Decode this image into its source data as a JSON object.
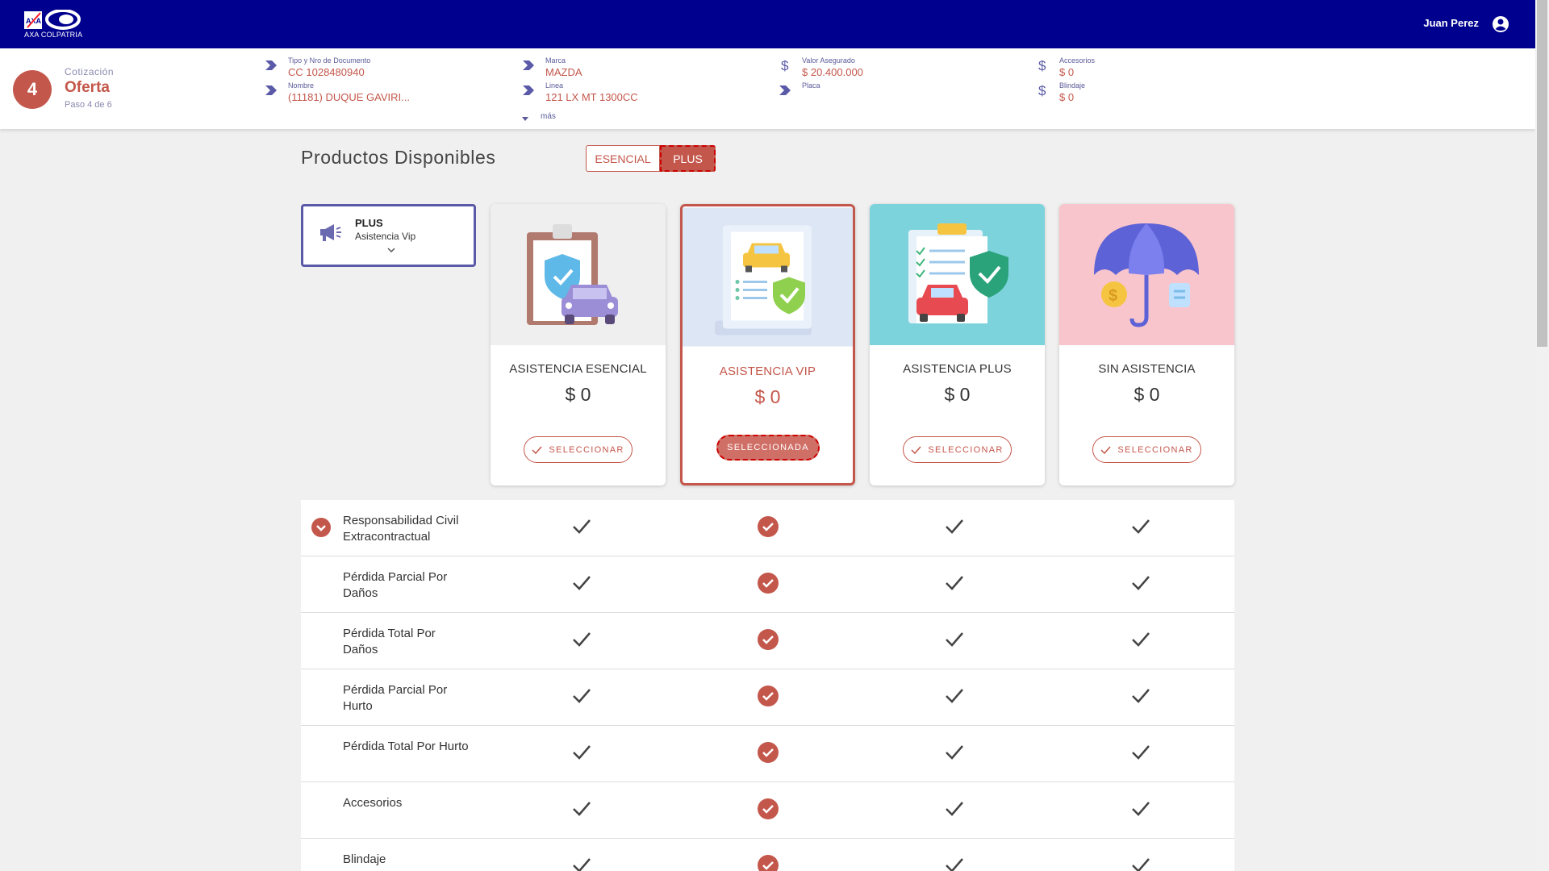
{
  "header": {
    "brand": "AXA COLPATRIA",
    "user_name": "Juan Perez"
  },
  "step": {
    "number": "4",
    "kicker": "Cotización",
    "title": "Oferta",
    "subtitle": "Paso 4 de 6"
  },
  "summary": {
    "doc_label": "Tipo y Nro de Documento",
    "doc_value": "CC 1028480940",
    "name_label": "Nombre",
    "name_value": "(11181) DUQUE GAVIRI...",
    "marca_label": "Marca",
    "marca_value": "MAZDA",
    "linea_label": "Linea",
    "linea_value": "121 LX MT 1300CC",
    "mas": "más",
    "valor_label": "Valor Asegurado",
    "valor_value": "$ 20.400.000",
    "placa_label": "Placa",
    "placa_value": "",
    "accesorios_label": "Accesorios",
    "accesorios_value": "$ 0",
    "blindaje_label": "Blindaje",
    "blindaje_value": "$ 0"
  },
  "main": {
    "title": "Productos Disponibles",
    "toggle": [
      "ESENCIAL",
      "PLUS"
    ],
    "toggle_selected": "PLUS",
    "plan_select": {
      "title": "PLUS",
      "subtitle": "Asistencia Vip"
    }
  },
  "cards": [
    {
      "name": "ASISTENCIA ESENCIAL",
      "price": "$ 0",
      "button": "SELECCIONAR",
      "selected": false,
      "bg": "#efefef"
    },
    {
      "name": "ASISTENCIA VIP",
      "price": "$ 0",
      "button": "SELECCIONADA",
      "selected": true,
      "bg": "#dce6f4"
    },
    {
      "name": "ASISTENCIA PLUS",
      "price": "$ 0",
      "button": "SELECCIONAR",
      "selected": false,
      "bg": "#7dd3dc"
    },
    {
      "name": "SIN ASISTENCIA",
      "price": "$ 0",
      "button": "SELECCIONAR",
      "selected": false,
      "bg": "#f8c5cc"
    }
  ],
  "coverages": [
    {
      "label": "Responsabilidad Civil Extracontractual",
      "expandable": true
    },
    {
      "label": "Pérdida Parcial Por Daños",
      "expandable": false
    },
    {
      "label": "Pérdida Total Por Daños",
      "expandable": false
    },
    {
      "label": "Pérdida Parcial Por Hurto",
      "expandable": false
    },
    {
      "label": "Pérdida Total Por Hurto",
      "expandable": false
    },
    {
      "label": "Accesorios",
      "expandable": false
    },
    {
      "label": "Blindaje",
      "expandable": false
    }
  ],
  "icons": {
    "step_field": "chevron-right-icon",
    "money_field": "dollar-icon",
    "plan": "megaphone-icon",
    "check": "check-icon",
    "check_selected": "check-circle-icon",
    "expand": "chevron-down-circle-icon",
    "user": "user-circle-icon"
  },
  "colors": {
    "brand_blue": "#00008f",
    "accent": "#c4574b",
    "label": "#5a5a9a"
  }
}
